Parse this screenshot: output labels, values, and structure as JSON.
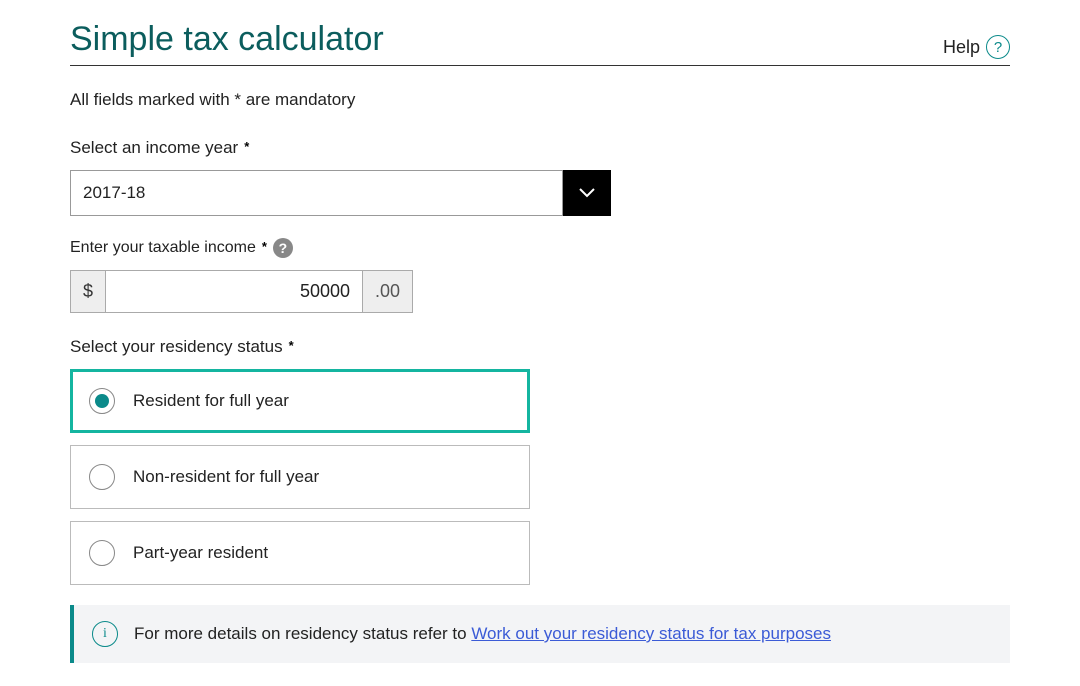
{
  "header": {
    "title": "Simple tax calculator",
    "help_label": "Help",
    "help_glyph": "?"
  },
  "mandatory_note": "All fields marked with * are mandatory",
  "income_year": {
    "label": "Select an income year",
    "selected": "2017-18"
  },
  "taxable_income": {
    "label": "Enter your taxable income",
    "prefix": "$",
    "value": "50000",
    "suffix": ".00"
  },
  "residency": {
    "label": "Select your residency status",
    "options": [
      {
        "label": "Resident for full year",
        "selected": true
      },
      {
        "label": "Non-resident for full year",
        "selected": false
      },
      {
        "label": "Part-year resident",
        "selected": false
      }
    ]
  },
  "info_banner": {
    "text": "For more details on residency status refer to ",
    "link_text": "Work out your residency status for tax purposes"
  }
}
